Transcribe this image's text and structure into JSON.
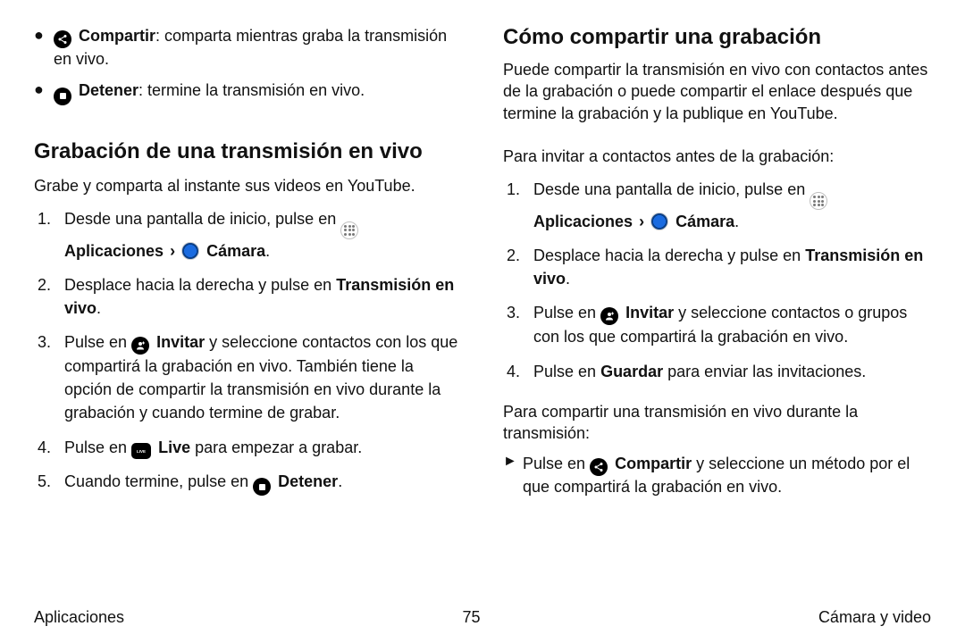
{
  "left": {
    "bullets": [
      {
        "icon": "share-icon",
        "title": "Compartir",
        "rest": ": comparta mientras graba la transmisión en vivo."
      },
      {
        "icon": "stop-icon",
        "title": "Detener",
        "rest": ": termine la transmisión en vivo."
      }
    ],
    "heading": "Grabación de una transmisión en vivo",
    "intro": "Grabe y comparta al instante sus videos en YouTube.",
    "steps": {
      "s1_a": "Desde una pantalla de inicio, pulse en ",
      "s1_apps": "Aplicaciones",
      "s1_chev": "›",
      "s1_cam": "Cámara",
      "s1_end": ".",
      "s2_a": "Desplace hacia la derecha y pulse en ",
      "s2_b": "Transmisión en vivo",
      "s2_end": ".",
      "s3_a": "Pulse en ",
      "s3_b": "Invitar",
      "s3_c": " y seleccione contactos con los que compartirá la grabación en vivo. También tiene la opción de compartir la transmisión en vivo durante la grabación y cuando termine de grabar.",
      "s4_a": "Pulse en ",
      "s4_b": "Live",
      "s4_c": " para empezar a grabar.",
      "s5_a": "Cuando termine, pulse en ",
      "s5_b": "Detener",
      "s5_end": "."
    }
  },
  "right": {
    "heading": "Cómo compartir una grabación",
    "intro": "Puede compartir la transmisión en vivo con contactos antes de la grabación o puede compartir el enlace después que termine la grabación y la publique en YouTube.",
    "lead": "Para invitar a contactos antes de la grabación:",
    "steps": {
      "s1_a": "Desde una pantalla de inicio, pulse en ",
      "s1_apps": "Aplicaciones",
      "s1_chev": "›",
      "s1_cam": "Cámara",
      "s1_end": ".",
      "s2_a": "Desplace hacia la derecha y pulse en ",
      "s2_b": "Transmisión en vivo",
      "s2_end": ".",
      "s3_a": "Pulse en ",
      "s3_b": "Invitar",
      "s3_c": " y seleccione contactos o grupos con los que compartirá la grabación en vivo.",
      "s4_a": "Pulse en ",
      "s4_b": "Guardar",
      "s4_c": " para enviar las invitaciones."
    },
    "lead2": "Para compartir una transmisión en vivo durante la transmisión:",
    "tri": {
      "a": "Pulse en ",
      "b": "Compartir",
      "c": " y seleccione un método por el que compartirá la grabación en vivo."
    }
  },
  "footer": {
    "left": "Aplicaciones",
    "center": "75",
    "right": "Cámara y video"
  }
}
